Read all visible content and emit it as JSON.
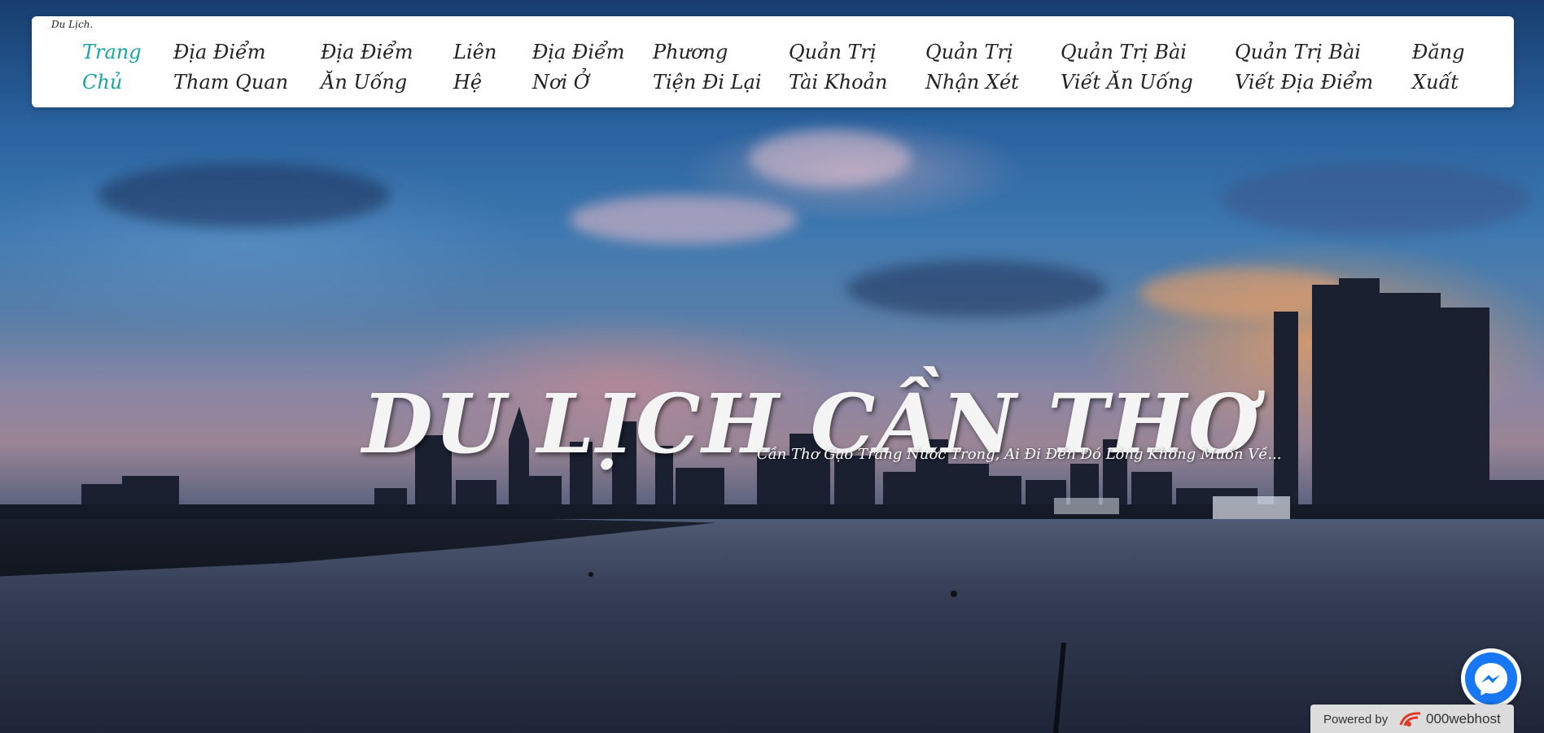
{
  "brand": "Du Lịch.",
  "nav": {
    "items": [
      {
        "line1": "Trang",
        "line2": "Chủ",
        "active": true
      },
      {
        "line1": "Địa Điểm",
        "line2": "Tham Quan",
        "active": false
      },
      {
        "line1": "Địa Điểm",
        "line2": "Ăn Uống",
        "active": false
      },
      {
        "line1": "Liên",
        "line2": "Hệ",
        "active": false
      },
      {
        "line1": "Địa Điểm",
        "line2": "Nơi Ở",
        "active": false
      },
      {
        "line1": "Phương",
        "line2": "Tiện Đi Lại",
        "active": false
      },
      {
        "line1": "Quản Trị",
        "line2": "Tài Khoản",
        "active": false
      },
      {
        "line1": "Quản Trị",
        "line2": "Nhận Xét",
        "active": false
      },
      {
        "line1": "Quản Trị Bài",
        "line2": "Viết Ăn Uống",
        "active": false
      },
      {
        "line1": "Quản Trị Bài",
        "line2": "Viết Địa Điểm",
        "active": false
      },
      {
        "line1": "Đăng",
        "line2": "Xuất",
        "active": false
      }
    ]
  },
  "hero": {
    "title": "DU LỊCH CẦN THƠ",
    "subtitle": "Cần Thơ Gạo Trắng Nước Trong, Ai Đi Đến Đó Lòng Không Muốn Về..."
  },
  "messenger": {
    "icon": "messenger-icon"
  },
  "powered": {
    "label": "Powered by",
    "brand": "000webhost",
    "icon": "000webhost-logo-icon"
  },
  "colors": {
    "nav_active": "#1aa5a5",
    "nav_text": "#222222",
    "messenger": "#1877f2",
    "powered_bg": "#dcdcdc"
  }
}
